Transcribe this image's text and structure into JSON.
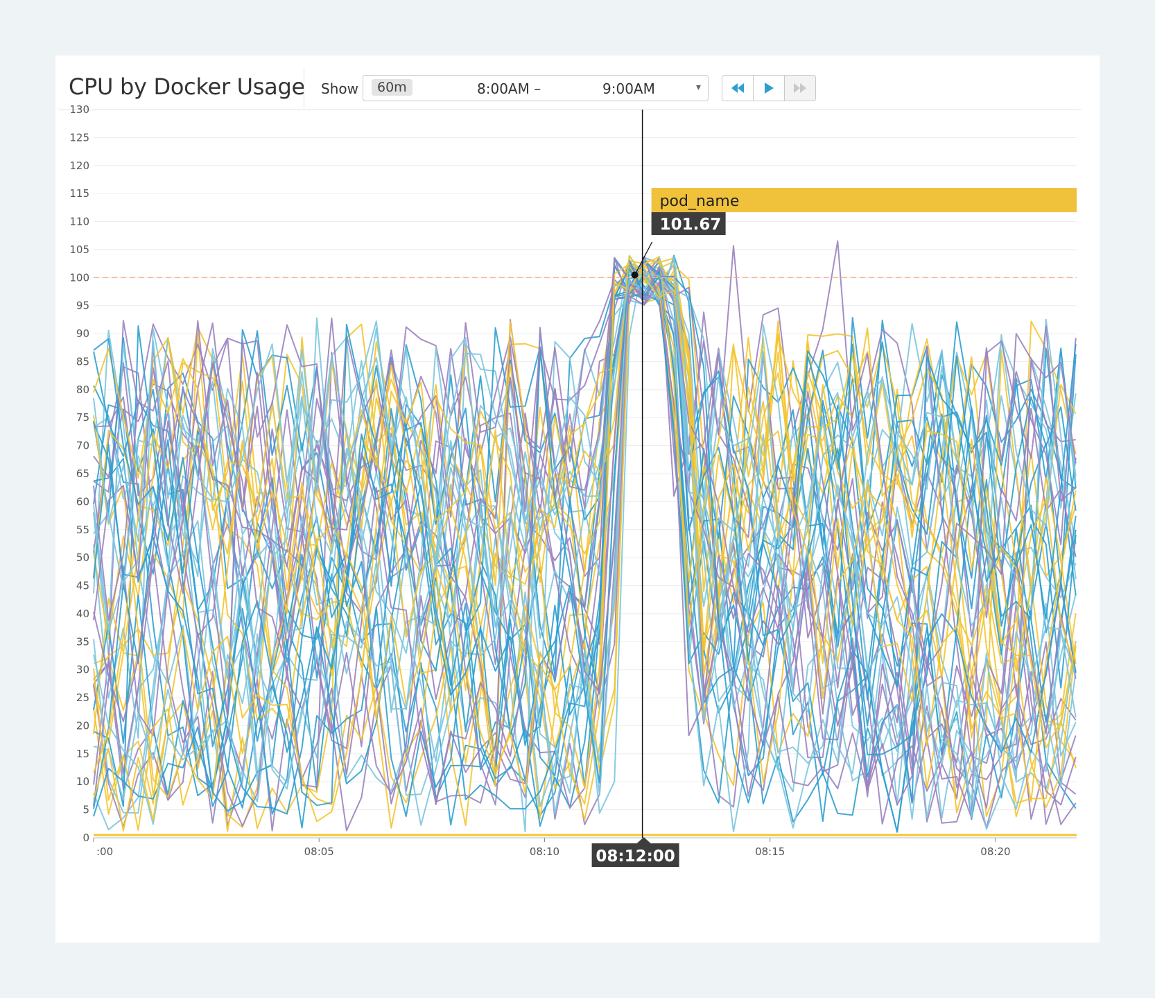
{
  "widget": {
    "title": "CPU by Docker Usage",
    "show_label": "Show",
    "span": "60m",
    "range_start": "8:00AM –",
    "range_end": "9:00AM",
    "caret": "▾"
  },
  "playback": [
    {
      "name": "rewind-icon"
    },
    {
      "name": "play-icon"
    },
    {
      "name": "fast-forward-icon"
    }
  ],
  "colors": {
    "accent_blue": "#2e9fd0",
    "purple": "#9b82bf",
    "yellow": "#f4c430",
    "light_blue": "#7cc5df",
    "threshold": "#f2b28a",
    "tooltip_bar": "#f0c23b",
    "tooltip_value_bg": "#3d3d3d"
  },
  "tooltip": {
    "series_name": "pod_name",
    "value": "101.67",
    "time": "08:12:00"
  },
  "chart_data": {
    "type": "line",
    "ylim": [
      0,
      130
    ],
    "yticks": [
      0,
      5,
      10,
      15,
      20,
      25,
      30,
      35,
      40,
      45,
      50,
      55,
      60,
      65,
      70,
      75,
      80,
      85,
      90,
      95,
      100,
      105,
      110,
      115,
      120,
      125,
      130
    ],
    "xlim": [
      0,
      21.8
    ],
    "xticks": [
      {
        "value": 0,
        "label": ":00"
      },
      {
        "value": 5,
        "label": "08:05"
      },
      {
        "value": 10,
        "label": "08:10"
      },
      {
        "value": 15,
        "label": "08:15"
      },
      {
        "value": 20,
        "label": "08:20"
      }
    ],
    "threshold": 100,
    "cursor_x": 12.17,
    "cursor_y": 101.67,
    "grid": true,
    "series_count": 48,
    "series_colors": [
      "#2e9fd0",
      "#9b82bf",
      "#f4c430",
      "#7cc5df"
    ],
    "profile": {
      "normal_range": [
        5,
        80
      ],
      "spike_start": 11.3,
      "spike_peak_range": [
        11.7,
        12.9
      ],
      "spike_end": 13.4,
      "spike_range": [
        95,
        104
      ],
      "outlier_peak": 108,
      "baseline": 0.5
    }
  }
}
